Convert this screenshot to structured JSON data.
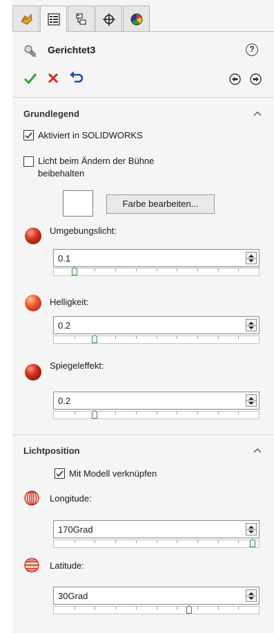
{
  "tabs": [
    {
      "icon": "feature-manager-icon",
      "active": false
    },
    {
      "icon": "property-manager-icon",
      "active": true
    },
    {
      "icon": "configuration-manager-icon",
      "active": false
    },
    {
      "icon": "dimxpert-manager-icon",
      "active": false
    },
    {
      "icon": "display-manager-icon",
      "active": false
    }
  ],
  "header": {
    "title": "Gerichtet3",
    "help": "?"
  },
  "sections": {
    "basic": {
      "title": "Grundlegend",
      "activate_label": "Aktiviert in SOLIDWORKS",
      "activate_checked": true,
      "keep_light_label_1": "Licht beim Ändern der Bühne",
      "keep_light_label_2": "beibehalten",
      "keep_light_checked": false,
      "edit_color_label": "Farbe bearbeiten...",
      "ambient_label": "Umgebungslicht:",
      "ambient_value": "0.1",
      "ambient_fraction": 0.1,
      "brightness_label": "Helligkeit:",
      "brightness_value": "0.2",
      "brightness_fraction": 0.2,
      "specular_label": "Spiegeleffekt:",
      "specular_value": "0.2",
      "specular_fraction": 0.2
    },
    "position": {
      "title": "Lichtposition",
      "lock_model_label": "Mit Modell verknüpfen",
      "lock_model_checked": true,
      "longitude_label": "Longitude:",
      "longitude_value": "170Grad",
      "longitude_fraction": 0.97,
      "latitude_label": "Latitude:",
      "latitude_value": "30Grad",
      "latitude_fraction": 0.66
    }
  },
  "colors": {
    "accept": "#2ea043",
    "cancel": "#e0201b",
    "sphere": "#c0271a"
  }
}
